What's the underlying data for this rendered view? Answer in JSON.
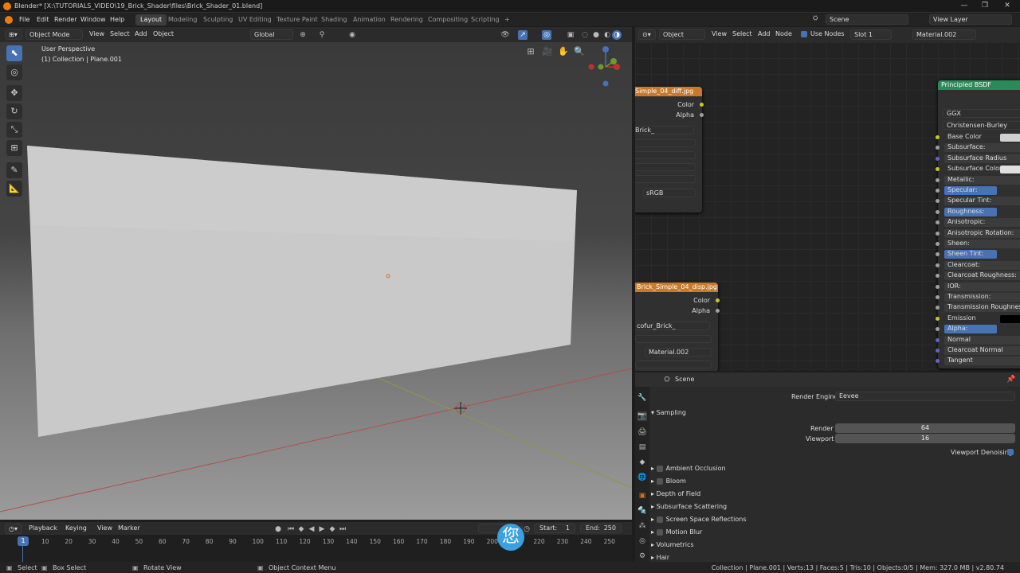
{
  "titlebar": {
    "text": "Blender* [X:\\TUTORIALS_VIDEO\\19_Brick_Shader\\files\\Brick_Shader_01.blend]",
    "minimize": "—",
    "maximize": "❐",
    "close": "✕"
  },
  "menu": {
    "items": [
      "File",
      "Edit",
      "Render",
      "Window",
      "Help"
    ]
  },
  "workspaces": [
    "Layout",
    "Modeling",
    "Sculpting",
    "UV Editing",
    "Texture Paint",
    "Shading",
    "Animation",
    "Rendering",
    "Compositing",
    "Scripting"
  ],
  "workspace_add": "+",
  "scene": {
    "label": "Scene",
    "view_layer": "View Layer"
  },
  "viewport_header": {
    "mode": "Object Mode",
    "menus": [
      "View",
      "Select",
      "Add",
      "Object"
    ],
    "orientation": "Global"
  },
  "viewport": {
    "perspective": "User Perspective",
    "collection": "(1) Collection | Plane.001"
  },
  "node_header": {
    "editor": "Object",
    "menus": [
      "View",
      "Select",
      "Add",
      "Node"
    ],
    "use_nodes": "Use Nodes",
    "slot": "Slot 1",
    "material": "Material.002"
  },
  "node1": {
    "title": "Simple_04_diff.jpg",
    "out_color": "Color",
    "out_alpha": "Alpha",
    "image": "Brick_",
    "colorspace": "sRGB"
  },
  "node2": {
    "title": "Brick_Simple_04_disp.jpg",
    "out_color": "Color",
    "out_alpha": "Alpha",
    "image": "cofur_Brick_",
    "material": "Material.002"
  },
  "bsdf": {
    "title": "Principled BSDF",
    "distribution": "GGX",
    "subsurface_method": "Christensen-Burley",
    "inputs": [
      "Base Color",
      "Subsurface:",
      "Subsurface Radius",
      "Subsurface Color",
      "Metallic:",
      "Specular:",
      "Specular Tint:",
      "Roughness:",
      "Anisotropic:",
      "Anisotropic Rotation:",
      "Sheen:",
      "Sheen Tint:",
      "Clearcoat:",
      "Clearcoat Roughness:",
      "IOR:",
      "Transmission:",
      "Transmission Roughness:",
      "Emission",
      "Alpha:",
      "Normal",
      "Clearcoat Normal",
      "Tangent"
    ],
    "highlighted": [
      "Specular:",
      "Roughness:",
      "Sheen Tint:",
      "Alpha:"
    ],
    "socket_colors": {
      "color": "#c7c729",
      "float": "#a1a1a1",
      "vector": "#6363c7"
    }
  },
  "properties": {
    "context": "Scene",
    "render_engine_label": "Render Engine",
    "render_engine": "Eevee",
    "sampling": "Sampling",
    "render_label": "Render",
    "render_value": "64",
    "viewport_label": "Viewport",
    "viewport_value": "16",
    "denoise": "Viewport Denoising",
    "sections": [
      {
        "label": "Ambient Occlusion",
        "checkbox": true
      },
      {
        "label": "Bloom",
        "checkbox": true
      },
      {
        "label": "Depth of Field",
        "checkbox": false
      },
      {
        "label": "Subsurface Scattering",
        "checkbox": false
      },
      {
        "label": "Screen Space Reflections",
        "checkbox": true
      },
      {
        "label": "Motion Blur",
        "checkbox": true
      },
      {
        "label": "Volumetrics",
        "checkbox": false
      },
      {
        "label": "Hair",
        "checkbox": false
      }
    ]
  },
  "timeline": {
    "menus": [
      "Playback",
      "Keying",
      "View",
      "Marker"
    ],
    "current": "1",
    "start_label": "Start:",
    "start": "1",
    "end_label": "End:",
    "end": "250",
    "ticks": [
      "10",
      "20",
      "30",
      "40",
      "50",
      "60",
      "70",
      "80",
      "90",
      "100",
      "110",
      "120",
      "130",
      "140",
      "150",
      "160",
      "170",
      "180",
      "190",
      "200",
      "210",
      "220",
      "230",
      "240",
      "250"
    ]
  },
  "overlay_char": "您",
  "status": {
    "left": [
      "Select",
      "Box Select",
      "Rotate View",
      "Object Context Menu"
    ],
    "right": "Collection | Plane.001 | Verts:13 | Faces:5 | Tris:10 | Objects:0/5 | Mem: 327.0 MB | v2.80.74"
  },
  "colors": {
    "accent": "#4772b3",
    "node_image_header": "#c8792a",
    "node_shader_header": "#2a8a5a"
  }
}
